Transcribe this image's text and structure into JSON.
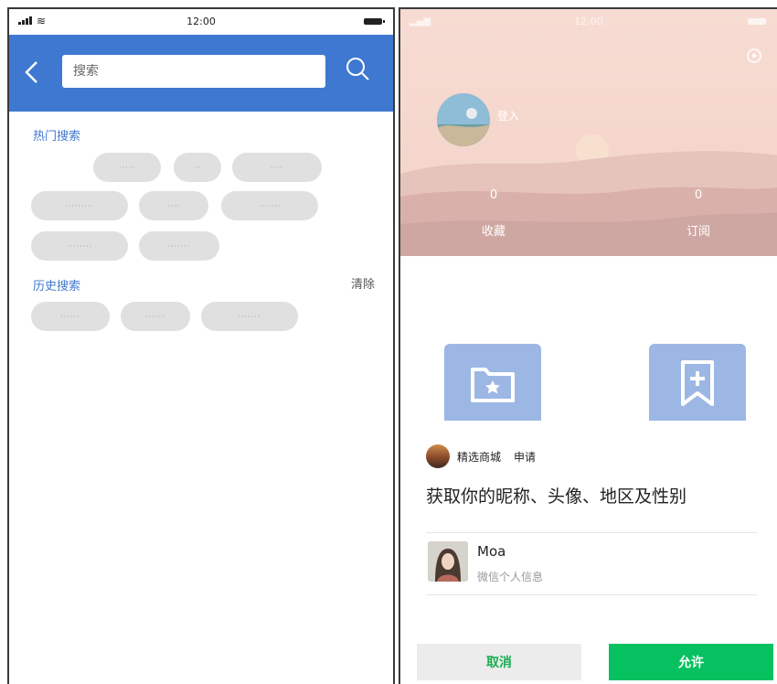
{
  "left": {
    "status": {
      "time": "12:00"
    },
    "search": {
      "placeholder": "搜索"
    },
    "hot": {
      "title": "热门搜索",
      "tags": [
        "·····",
        "··",
        "····",
        "·········",
        "····",
        "·······",
        "········",
        "·······"
      ]
    },
    "history": {
      "title": "历史搜索",
      "clear_label": "清除",
      "tags": [
        "······",
        "······",
        "·······"
      ]
    }
  },
  "right": {
    "profile": {
      "login_label": "登入",
      "favorites_count": "0",
      "favorites_label": "收藏",
      "subscriptions_count": "0",
      "subscriptions_label": "订阅"
    },
    "auth": {
      "app_name": "精选商城",
      "action": "申请",
      "permission_text": "获取你的昵称、头像、地区及性别",
      "user_name": "Moa",
      "user_desc": "微信个人信息",
      "cancel_label": "取消",
      "allow_label": "允许"
    }
  },
  "colors": {
    "primary_blue": "#3f78d0",
    "allow_green": "#07c160",
    "chip_gray": "#e0e0e0",
    "feature_blue": "#9cb7e3"
  },
  "icons": [
    "back-icon",
    "search-icon",
    "settings-icon",
    "folder-star-icon",
    "bookmark-plus-icon"
  ]
}
